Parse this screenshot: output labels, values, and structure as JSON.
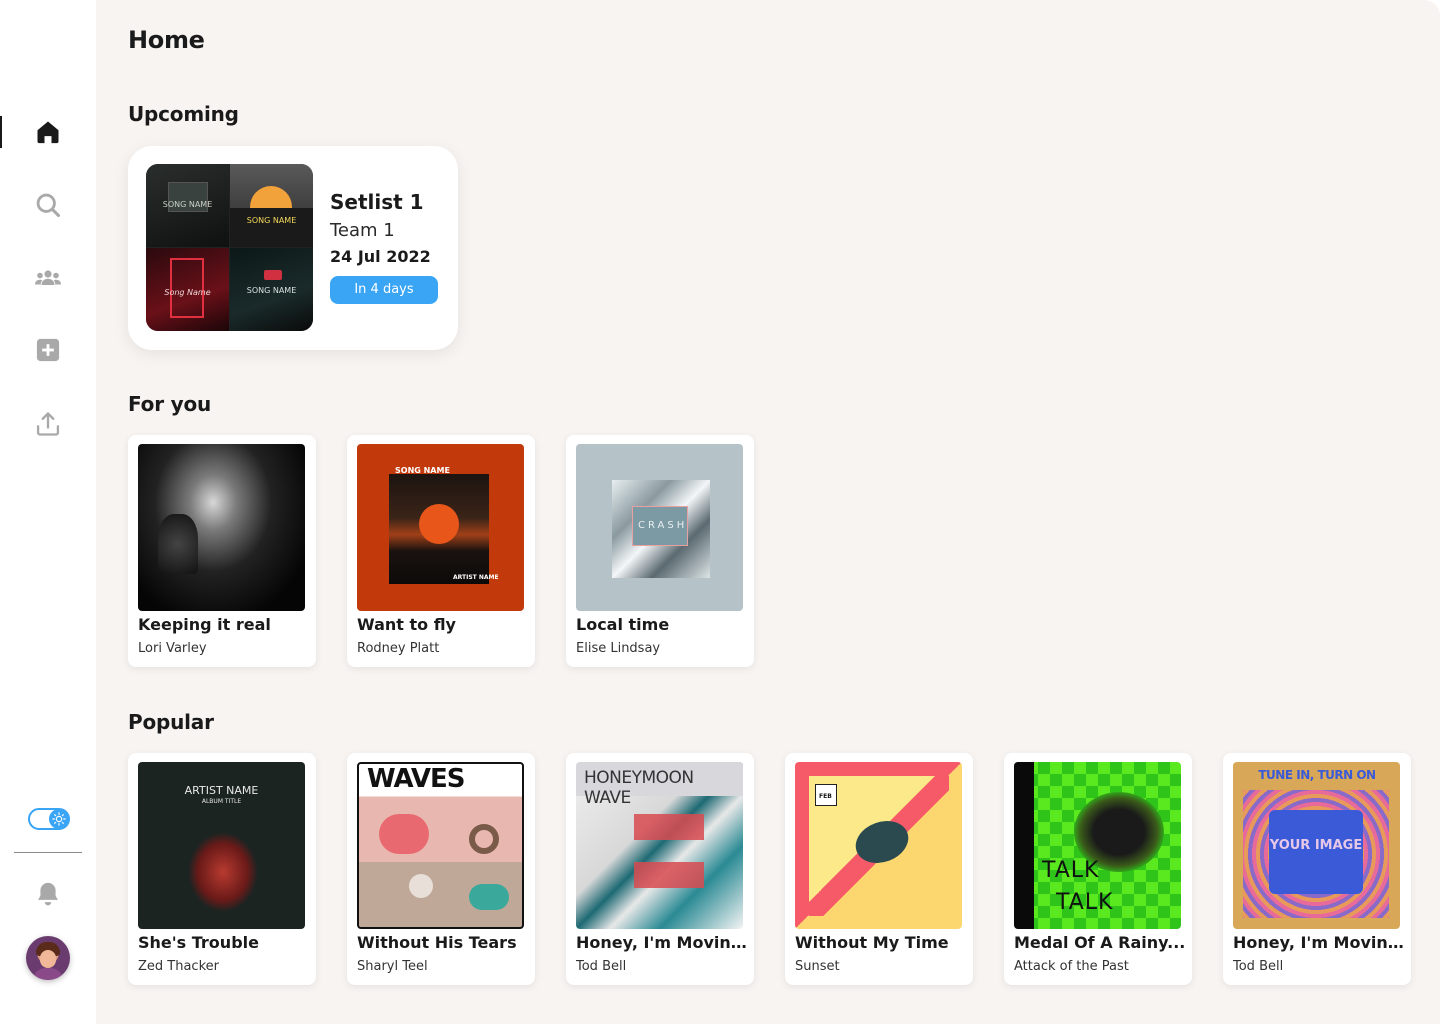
{
  "nav": {
    "items": [
      {
        "id": "home",
        "icon": "home-icon",
        "active": true
      },
      {
        "id": "search",
        "icon": "search-icon",
        "active": false
      },
      {
        "id": "teams",
        "icon": "users-icon",
        "active": false
      },
      {
        "id": "add",
        "icon": "add-square-icon",
        "active": false
      },
      {
        "id": "upload",
        "icon": "upload-icon",
        "active": false
      }
    ],
    "theme_toggle_icon": "sun-icon",
    "notification_icon": "bell-icon"
  },
  "page": {
    "title": "Home"
  },
  "upcoming": {
    "heading": "Upcoming",
    "setlist_name": "Setlist 1",
    "team": "Team 1",
    "date": "24 Jul 2022",
    "badge": "In 4 days",
    "mosaic_labels": [
      "SONG NAME",
      "SONG NAME",
      "Song Name",
      "SONG NAME"
    ]
  },
  "for_you": {
    "heading": "For you",
    "items": [
      {
        "title": "Keeping it real",
        "artist": "Lori Varley"
      },
      {
        "title": "Want to fly",
        "artist": "Rodney Platt",
        "cover_text": "SONG NAME",
        "cover_sub": "ARTIST NAME"
      },
      {
        "title": "Local time",
        "artist": "Elise Lindsay",
        "cover_text": "CRASH"
      }
    ]
  },
  "popular": {
    "heading": "Popular",
    "items": [
      {
        "title": "She's Trouble",
        "artist": "Zed Thacker",
        "cover_text": "ARTIST NAME",
        "cover_sub": "ALBUM TITLE"
      },
      {
        "title": "Without His Tears",
        "artist": "Sharyl Teel",
        "cover_text": "WAVES"
      },
      {
        "title": "Honey, I'm Moving...",
        "artist": "Tod Bell",
        "cover_text": "HONEYMOON WAVE"
      },
      {
        "title": "Without My Time",
        "artist": "Sunset",
        "cover_text": "FEB"
      },
      {
        "title": "Medal Of A Rainy...",
        "artist": "Attack of the Past",
        "cover_text": "TALK",
        "cover_sub": "TALK"
      },
      {
        "title": "Honey, I'm Moving...",
        "artist": "Tod Bell",
        "cover_text": "TUNE IN, TURN ON",
        "cover_sub": "YOUR IMAGE"
      }
    ]
  },
  "colors": {
    "accent": "#3aa4f5",
    "background": "#f8f4f2",
    "text": "#1a1a1a"
  }
}
